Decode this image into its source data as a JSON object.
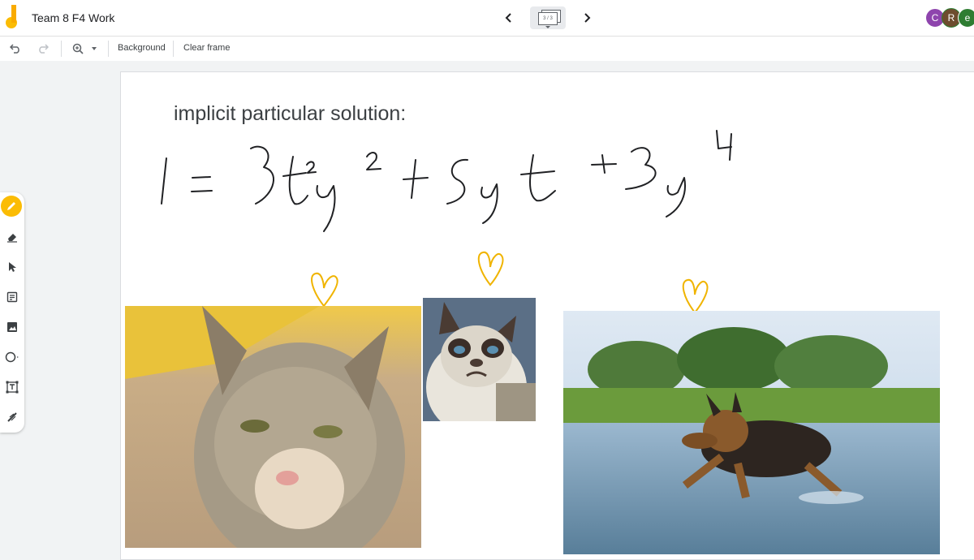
{
  "header": {
    "title": "Team 8 F4 Work",
    "frame_indicator": "3 / 3",
    "avatars": [
      {
        "letter": "C",
        "color": "#8e44ad"
      },
      {
        "letter": "R",
        "color": "#6d4c2e"
      },
      {
        "letter": "e",
        "color": "#2e7d32"
      }
    ]
  },
  "toolbar": {
    "background_label": "Background",
    "clear_frame_label": "Clear frame"
  },
  "canvas": {
    "title": "implicit particular solution:"
  },
  "colors": {
    "accent": "#fbbc04",
    "ink": "#202124",
    "heart": "#f0b400"
  },
  "tools": [
    "pen-icon",
    "eraser-icon",
    "select-icon",
    "sticky-note-icon",
    "image-icon",
    "circle-shape-icon",
    "text-box-icon",
    "laser-icon"
  ]
}
